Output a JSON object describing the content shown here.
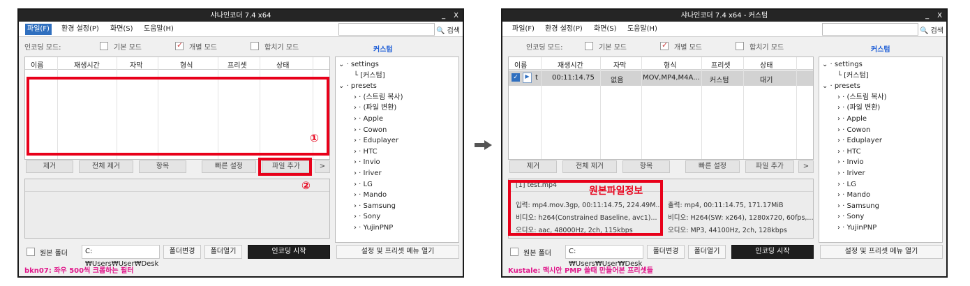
{
  "left": {
    "title": "샤나인코더 7.4 x64",
    "titlebar_buttons": [
      "_",
      "X"
    ],
    "menu": [
      "파일(F)",
      "환경 설정(P)",
      "화면(S)",
      "도움말(H)"
    ],
    "search_label": "검색",
    "mode_label": "인코딩 모드:",
    "modes": [
      "기본 모드",
      "개별 모드",
      "합치기 모드"
    ],
    "custom": "커스텀",
    "columns": [
      "이름",
      "재생시간",
      "자막",
      "형식",
      "프리셋",
      "상태"
    ],
    "tree": {
      "root1": "settings",
      "child1": "[커스텀]",
      "root2": "presets",
      "items": [
        "(스트림 복사)",
        "(파일 변환)",
        "Apple",
        "Cowon",
        "Eduplayer",
        "HTC",
        "Invio",
        "Iriver",
        "LG",
        "Mando",
        "Samsung",
        "Sony",
        "YujinPNP"
      ]
    },
    "buttons": [
      "제거",
      "전체 제거",
      "항목",
      "빠른 설정",
      "파일 추가",
      ">"
    ],
    "original_folder": "원본 폴더",
    "folder_path": "C:₩Users₩User₩Desk",
    "folder_change": "폴더변경",
    "folder_open": "폴더열기",
    "encode": "인코딩 시작",
    "settings_menu": "설정 및 프리셋 메뉴 열기",
    "status": "bkn07: 좌우 500씩 크롭하는 필터",
    "circles": [
      "①",
      "②"
    ]
  },
  "right": {
    "title": "샤나인코더 7.4 x64 - 커스텀",
    "titlebar_buttons": [
      "_",
      "X"
    ],
    "menu": [
      "파일(F)",
      "환경 설정(P)",
      "화면(S)",
      "도움말(H)"
    ],
    "search_label": "검색",
    "mode_label": "인코딩 모드:",
    "modes": [
      "기본 모드",
      "개별 모드",
      "합치기 모드"
    ],
    "custom": "커스텀",
    "columns": [
      "이름",
      "재생시간",
      "자막",
      "형식",
      "프리셋",
      "상태"
    ],
    "row": {
      "name": "t",
      "duration": "00:11:14.75",
      "subtitle": "없음",
      "format": "MOV,MP4,M4A...",
      "preset": "커스텀",
      "status": "대기"
    },
    "tree": {
      "root1": "settings",
      "child1": "[커스텀]",
      "root2": "presets",
      "items": [
        "(스트림 복사)",
        "(파일 변환)",
        "Apple",
        "Cowon",
        "Eduplayer",
        "HTC",
        "Invio",
        "Iriver",
        "LG",
        "Mando",
        "Samsung",
        "Sony",
        "YujinPNP"
      ]
    },
    "buttons": [
      "제거",
      "전체 제거",
      "항목",
      "빠른 설정",
      "파일 추가",
      ">"
    ],
    "info": {
      "header": "[1] test.mp4",
      "label": "원본파일정보",
      "in": [
        "입력: mp4.mov.3gp, 00:11:14.75, 224.49M...",
        "비디오: h264(Constrained Baseline, avc1)...",
        "오디오: aac, 48000Hz, 2ch, 115kbps"
      ],
      "out": [
        "출력: mp4, 00:11:14.75, 171.17MiB",
        "비디오: H264(SW: x264), 1280x720, 60fps,...",
        "오디오: MP3, 44100Hz, 2ch, 128kbps"
      ]
    },
    "original_folder": "원본 폴더",
    "folder_path": "C:₩Users₩User₩Desk",
    "folder_change": "폴더변경",
    "folder_open": "폴더열기",
    "encode": "인코딩 시작",
    "settings_menu": "설정 및 프리셋 메뉴 열기",
    "status": "Kustale: 맥시안 PMP 쓸때 만들어본 프리셋들"
  },
  "colors": {
    "highlight": "#e8001a",
    "accent": "#1a5bd6",
    "status": "#e0178a"
  }
}
